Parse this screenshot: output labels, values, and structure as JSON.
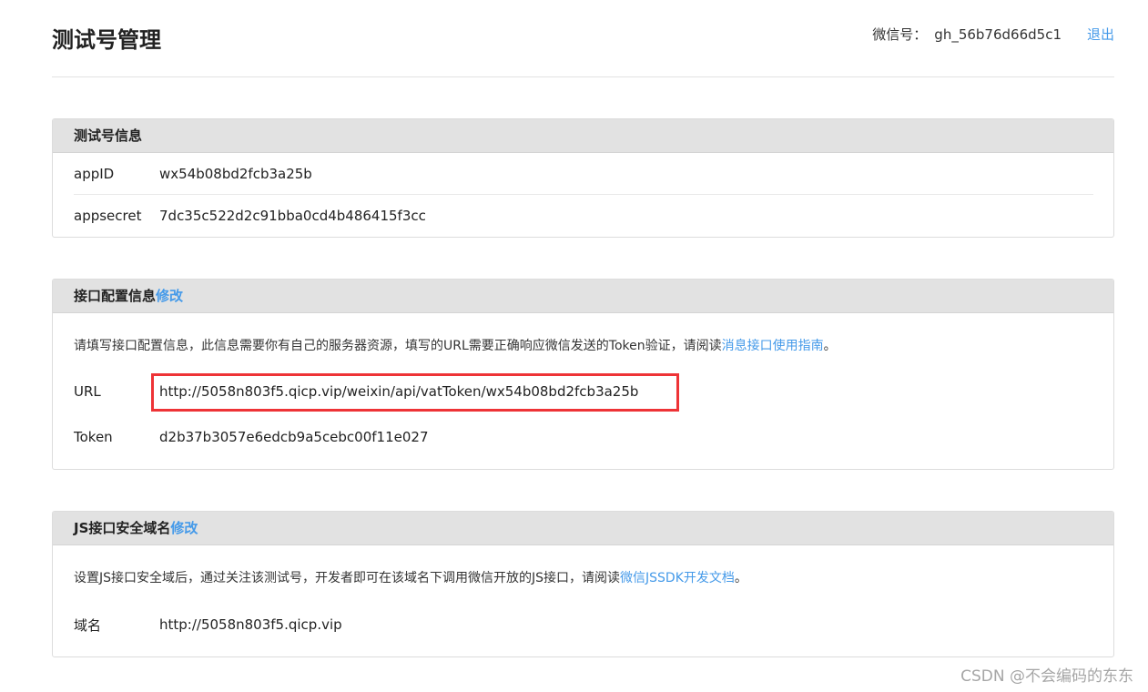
{
  "header": {
    "title": "测试号管理",
    "account_label": "微信号：",
    "account_value": "gh_56b76d66d5c1",
    "logout": "退出"
  },
  "test_account": {
    "title": "测试号信息",
    "appid_label": "appID",
    "appid_value": "wx54b08bd2fcb3a25b",
    "secret_label": "appsecret",
    "secret_value": "7dc35c522d2c91bba0cd4b486415f3cc"
  },
  "api_config": {
    "title": "接口配置信息",
    "edit": "修改",
    "desc": "请填写接口配置信息，此信息需要你有自己的服务器资源，填写的URL需要正确响应微信发送的Token验证，请阅读",
    "desc_link": "消息接口使用指南",
    "desc_end": "。",
    "url_label": "URL",
    "url_value": "http://5058n803f5.qicp.vip/weixin/api/vatToken/wx54b08bd2fcb3a25b",
    "token_label": "Token",
    "token_value": "d2b37b3057e6edcb9a5cebc00f11e027"
  },
  "js_domain": {
    "title": "JS接口安全域名",
    "edit": "修改",
    "desc": "设置JS接口安全域后，通过关注该测试号，开发者即可在该域名下调用微信开放的JS接口，请阅读",
    "desc_link": "微信JSSDK开发文档",
    "desc_end": "。",
    "domain_label": "域名",
    "domain_value": "http://5058n803f5.qicp.vip"
  },
  "watermark": "CSDN @不会编码的东东",
  "colors": {
    "link": "#459ae9",
    "highlight": "#ee3336",
    "panel_header": "#e2e2e2"
  }
}
